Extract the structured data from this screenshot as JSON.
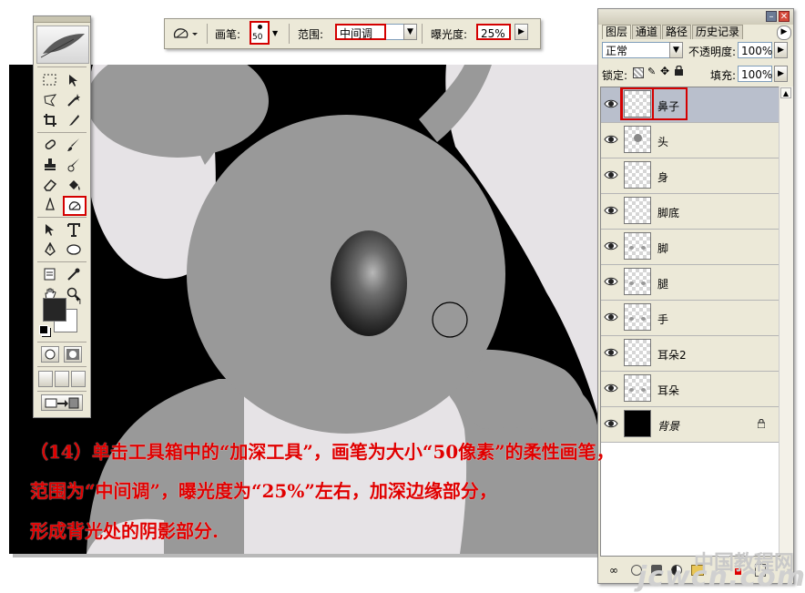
{
  "options_bar": {
    "brush_label": "画笔:",
    "brush_size": "50",
    "range_label": "范围:",
    "range_value": "中间调",
    "exposure_label": "曝光度:",
    "exposure_value": "25%"
  },
  "layers_panel": {
    "tabs": [
      "图层",
      "通道",
      "路径",
      "历史记录"
    ],
    "blend_mode": "正常",
    "opacity_label": "不透明度:",
    "opacity_value": "100%",
    "lock_label": "锁定:",
    "fill_label": "填充:",
    "fill_value": "100%",
    "layers": [
      {
        "name": "鼻子",
        "active": true
      },
      {
        "name": "头"
      },
      {
        "name": "身"
      },
      {
        "name": "脚底"
      },
      {
        "name": "脚"
      },
      {
        "name": "腿"
      },
      {
        "name": "手"
      },
      {
        "name": "耳朵2"
      },
      {
        "name": "耳朵"
      },
      {
        "name": "背景"
      }
    ]
  },
  "caption": {
    "line1": "（14）单击工具箱中的“加深工具”，画笔为大小“50像素”的柔性画笔，",
    "line2": "范围为“中间调”，曝光度为“25%”左右，加深边缘部分，",
    "line3": "形成背光处的阴影部分."
  },
  "watermark": {
    "line1": "中国教程网",
    "line2": "jcwcn.com"
  },
  "icons": {
    "selected_tool": "burn-tool-icon",
    "colors": {
      "canvas_bg": "#000000",
      "koala_gray": "#999999",
      "belly": "#e6e3e6",
      "highlight": "#d40000"
    }
  }
}
